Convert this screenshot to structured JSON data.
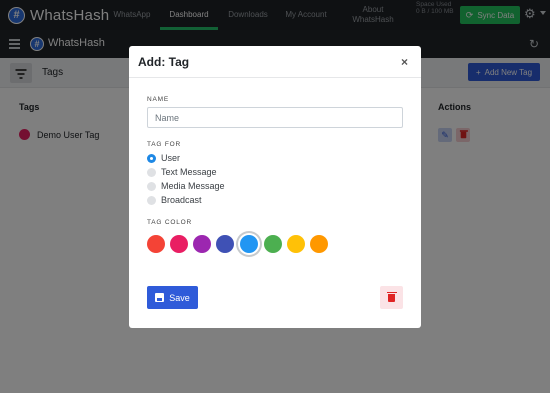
{
  "app": {
    "brand": "WhatsHash",
    "logo_glyph": "#"
  },
  "topnav": {
    "links": [
      {
        "label": "WhatsApp"
      },
      {
        "label": "Dashboard"
      },
      {
        "label": "Downloads"
      },
      {
        "label": "My Account"
      },
      {
        "label": "About WhatsHash"
      }
    ],
    "space_used": "Space Used 0 B / 100 MB",
    "sync_label": "Sync Data"
  },
  "subbar": {
    "title": "WhatsHash"
  },
  "page": {
    "title": "Tags",
    "add_button": "Add New Tag",
    "table": {
      "headers": [
        "Tags",
        "Actions"
      ],
      "rows": [
        {
          "name": "Demo User Tag",
          "color": "#e91e63"
        }
      ]
    }
  },
  "modal": {
    "title": "Add: Tag",
    "close": "×",
    "name_label": "NAME",
    "name_placeholder": "Name",
    "name_value": "",
    "tag_for_label": "TAG FOR",
    "tag_for_options": [
      "User",
      "Text Message",
      "Media Message",
      "Broadcast"
    ],
    "tag_for_selected": "User",
    "tag_color_label": "TAG COLOR",
    "colors": [
      "#f44336",
      "#e91e63",
      "#9c27b0",
      "#3f51b5",
      "#2196f3",
      "#4caf50",
      "#ffc107",
      "#ff9800"
    ],
    "selected_color": "#2196f3",
    "save_label": "Save"
  },
  "colors": {
    "accent": "#2f5bd9",
    "success": "#22c55e",
    "danger": "#e02424"
  }
}
